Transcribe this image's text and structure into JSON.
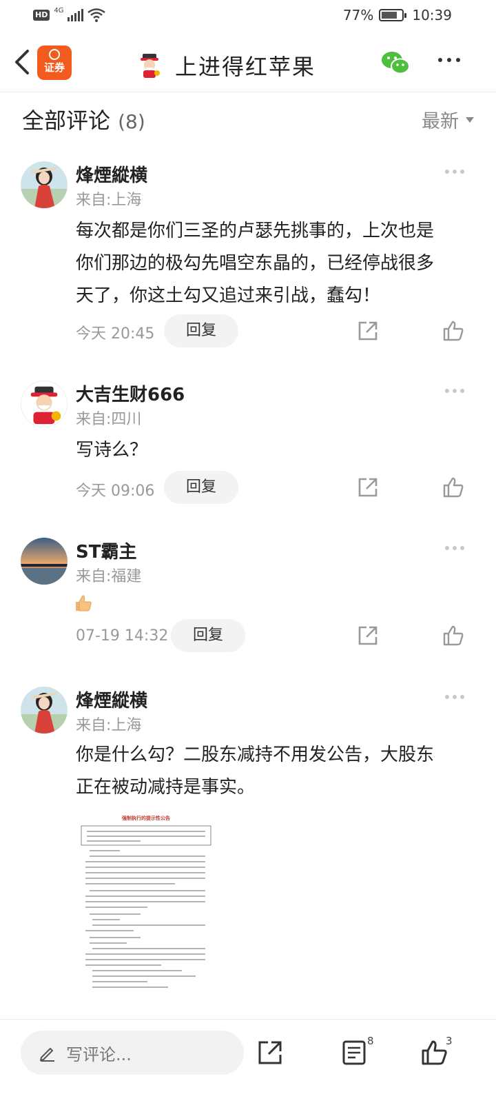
{
  "status": {
    "hd": "HD",
    "network": "4G",
    "battery_pct": "77%",
    "battery_level": 0.77,
    "time": "10:39"
  },
  "header": {
    "app_logo_label": "证券",
    "title": "上进得红苹果"
  },
  "section": {
    "title": "全部评论",
    "count": "(8)",
    "sort_label": "最新"
  },
  "comments": [
    {
      "name": "烽煙縱横",
      "location": "来自:上海",
      "text_lines": [
        "每次都是你们三圣的卢瑟先挑事的，上次也是",
        "你们那边的极勾先唱空东晶的，已经停战很多",
        "天了，你这土勾又追过来引战，蠢勾！"
      ],
      "time": "今天 20:45",
      "reply_label": "回复"
    },
    {
      "name": "大吉生财666",
      "location": "来自:四川",
      "text_lines": [
        "写诗么？"
      ],
      "time": "今天 09:06",
      "reply_label": "回复"
    },
    {
      "name": "ST霸主",
      "location": "来自:福建",
      "emoji": "thumbs-up",
      "time": "07-19 14:32",
      "reply_label": "回复"
    },
    {
      "name": "烽煙縱横",
      "location": "来自:上海",
      "text_lines": [
        "你是什么勾？二股东减持不用发公告，大股东",
        "正在被动减持是事实。"
      ],
      "image_title": "强制执行的提示性公告"
    }
  ],
  "bottom": {
    "placeholder": "写评论...",
    "comment_badge": "8",
    "like_badge": "3"
  },
  "colors": {
    "brand_orange": "#f25a1e",
    "wechat_green": "#4cbf3e"
  }
}
